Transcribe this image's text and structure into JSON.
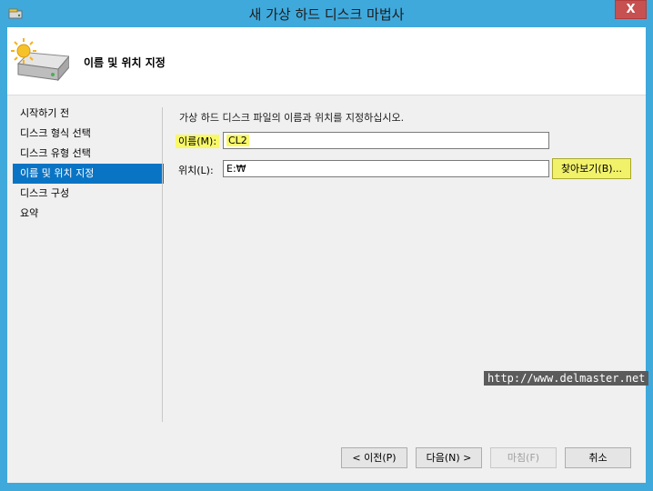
{
  "window": {
    "title": "새 가상 하드 디스크 마법사",
    "close_label": "X"
  },
  "header": {
    "title": "이름 및 위치 지정"
  },
  "sidebar": {
    "items": [
      {
        "label": "시작하기 전",
        "active": false
      },
      {
        "label": "디스크 형식 선택",
        "active": false
      },
      {
        "label": "디스크 유형 선택",
        "active": false
      },
      {
        "label": "이름 및 위치 지정",
        "active": true
      },
      {
        "label": "디스크 구성",
        "active": false
      },
      {
        "label": "요약",
        "active": false
      }
    ]
  },
  "main": {
    "description": "가상 하드 디스크 파일의 이름과 위치를 지정하십시오.",
    "name_label": "이름(M):",
    "name_value": "CL2",
    "location_label": "위치(L):",
    "location_value": "E:₩",
    "browse_label": "찾아보기(B)..."
  },
  "watermark": "http://www.delmaster.net",
  "footer": {
    "prev_label": "< 이전(P)",
    "next_label": "다음(N) >",
    "finish_label": "마침(F)",
    "cancel_label": "취소"
  },
  "colors": {
    "title_bar": "#3fa9dc",
    "active_item": "#0a74c4",
    "highlight": "#f8f86a",
    "close_button": "#c75050"
  }
}
